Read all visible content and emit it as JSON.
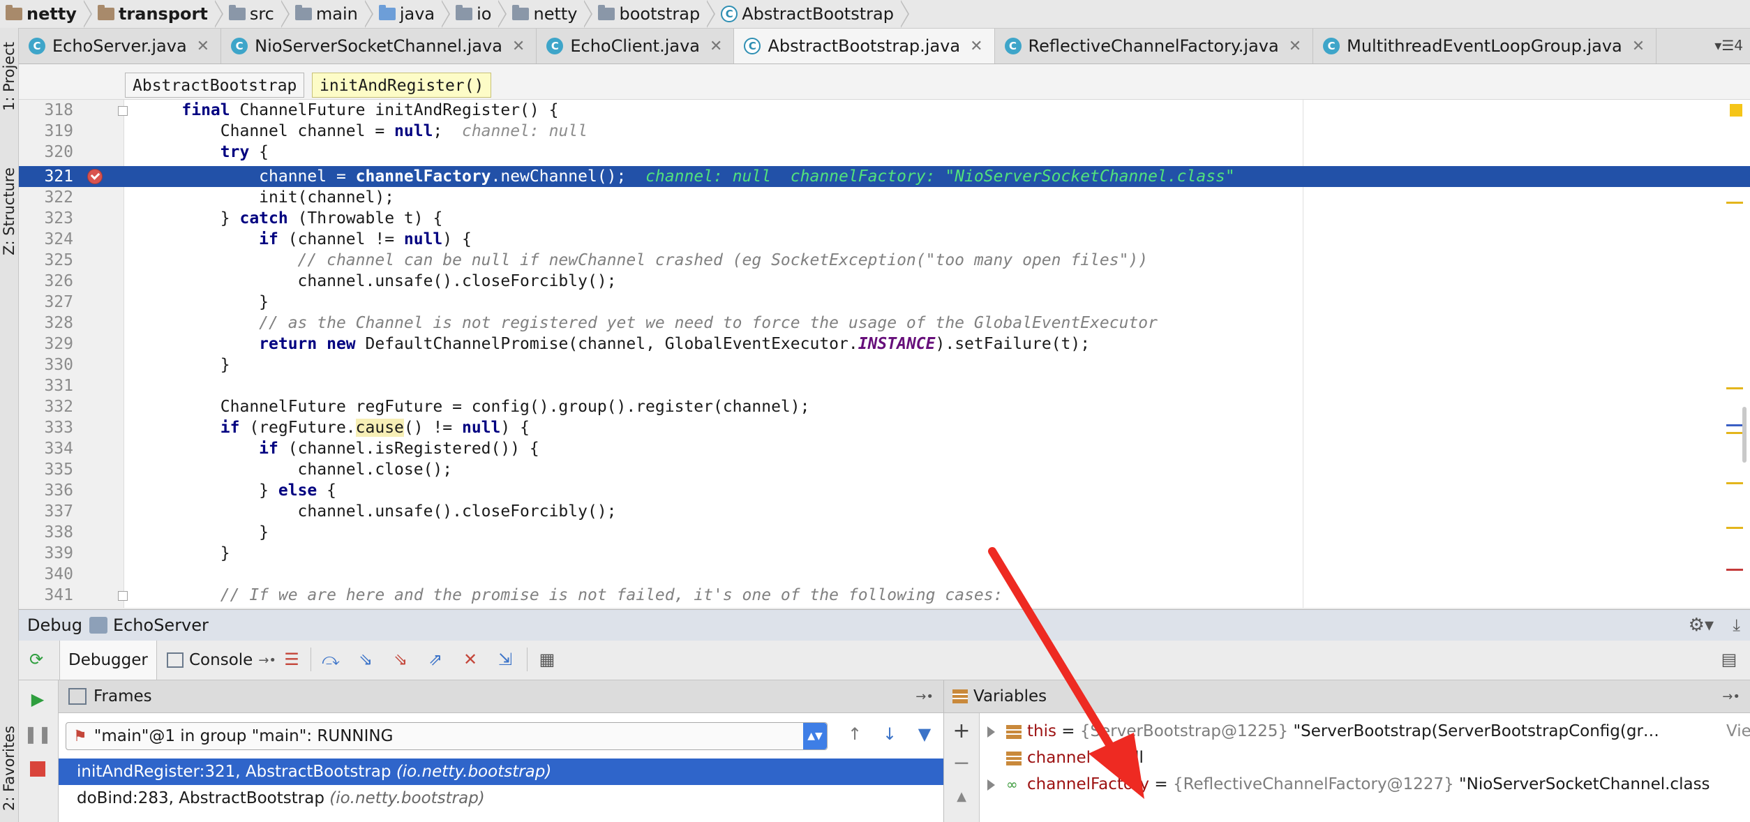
{
  "breadcrumbs": [
    "netty",
    "transport",
    "src",
    "main",
    "java",
    "io",
    "netty",
    "bootstrap",
    "AbstractBootstrap"
  ],
  "side_tools": {
    "project": "1: Project",
    "structure": "Z: Structure",
    "favorites": "2: Favorites"
  },
  "tabs": [
    {
      "label": "EchoServer.java",
      "active": false
    },
    {
      "label": "NioServerSocketChannel.java",
      "active": false
    },
    {
      "label": "EchoClient.java",
      "active": false
    },
    {
      "label": "AbstractBootstrap.java",
      "active": true
    },
    {
      "label": "ReflectiveChannelFactory.java",
      "active": false
    },
    {
      "label": "MultithreadEventLoopGroup.java",
      "active": false
    }
  ],
  "tabs_overflow": "4",
  "editor_crumbs": {
    "class": "AbstractBootstrap",
    "method": "initAndRegister()"
  },
  "editor": {
    "line_numbers": [
      "318",
      "319",
      "320",
      "321",
      "322",
      "323",
      "324",
      "325",
      "326",
      "327",
      "328",
      "329",
      "330",
      "331",
      "332",
      "333",
      "334",
      "335",
      "336",
      "337",
      "338",
      "339",
      "340",
      "341"
    ],
    "current_line": "321"
  },
  "debug": {
    "title": "Debug",
    "config": "EchoServer",
    "tab_debugger": "Debugger",
    "tab_console": "Console",
    "frames_title": "Frames",
    "variables_title": "Variables",
    "thread": "\"main\"@1 in group \"main\": RUNNING",
    "frames": [
      {
        "method": "initAndRegister:321, AbstractBootstrap",
        "pkg": "(io.netty.bootstrap)",
        "selected": true
      },
      {
        "method": "doBind:283, AbstractBootstrap",
        "pkg": "(io.netty.bootstrap)",
        "selected": false
      }
    ],
    "variables": [
      {
        "name": "this",
        "eq": " = ",
        "type": "{ServerBootstrap@1225}",
        "value": " \"ServerBootstrap(ServerBootstrapConfig(gr…",
        "link": "View"
      },
      {
        "name": "channel",
        "eq": " = ",
        "type": "",
        "value": "null",
        "link": ""
      },
      {
        "name": "channelFactory",
        "eq": " = ",
        "type": "{ReflectiveChannelFactory@1227}",
        "value": " \"NioServerSocketChannel.class",
        "link": ""
      }
    ]
  },
  "colors": {
    "selection": "#2251a8",
    "keyword": "#000080",
    "annotation_arrow": "#ee2a22"
  }
}
